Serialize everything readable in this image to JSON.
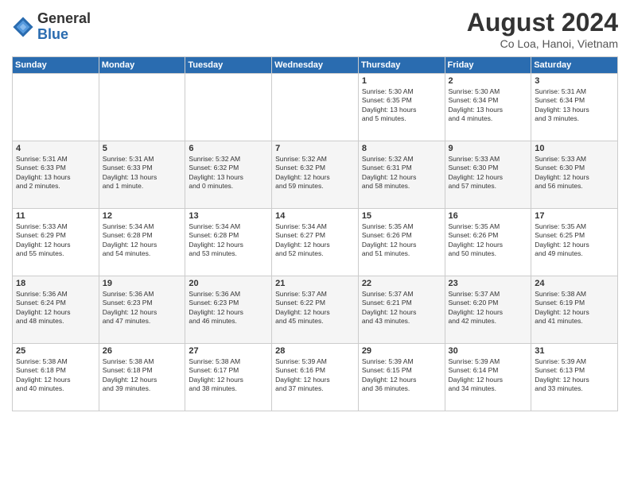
{
  "logo": {
    "general": "General",
    "blue": "Blue"
  },
  "header": {
    "month_year": "August 2024",
    "location": "Co Loa, Hanoi, Vietnam"
  },
  "days_of_week": [
    "Sunday",
    "Monday",
    "Tuesday",
    "Wednesday",
    "Thursday",
    "Friday",
    "Saturday"
  ],
  "weeks": [
    [
      {
        "day": "",
        "info": ""
      },
      {
        "day": "",
        "info": ""
      },
      {
        "day": "",
        "info": ""
      },
      {
        "day": "",
        "info": ""
      },
      {
        "day": "1",
        "info": "Sunrise: 5:30 AM\nSunset: 6:35 PM\nDaylight: 13 hours\nand 5 minutes."
      },
      {
        "day": "2",
        "info": "Sunrise: 5:30 AM\nSunset: 6:34 PM\nDaylight: 13 hours\nand 4 minutes."
      },
      {
        "day": "3",
        "info": "Sunrise: 5:31 AM\nSunset: 6:34 PM\nDaylight: 13 hours\nand 3 minutes."
      }
    ],
    [
      {
        "day": "4",
        "info": "Sunrise: 5:31 AM\nSunset: 6:33 PM\nDaylight: 13 hours\nand 2 minutes."
      },
      {
        "day": "5",
        "info": "Sunrise: 5:31 AM\nSunset: 6:33 PM\nDaylight: 13 hours\nand 1 minute."
      },
      {
        "day": "6",
        "info": "Sunrise: 5:32 AM\nSunset: 6:32 PM\nDaylight: 13 hours\nand 0 minutes."
      },
      {
        "day": "7",
        "info": "Sunrise: 5:32 AM\nSunset: 6:32 PM\nDaylight: 12 hours\nand 59 minutes."
      },
      {
        "day": "8",
        "info": "Sunrise: 5:32 AM\nSunset: 6:31 PM\nDaylight: 12 hours\nand 58 minutes."
      },
      {
        "day": "9",
        "info": "Sunrise: 5:33 AM\nSunset: 6:30 PM\nDaylight: 12 hours\nand 57 minutes."
      },
      {
        "day": "10",
        "info": "Sunrise: 5:33 AM\nSunset: 6:30 PM\nDaylight: 12 hours\nand 56 minutes."
      }
    ],
    [
      {
        "day": "11",
        "info": "Sunrise: 5:33 AM\nSunset: 6:29 PM\nDaylight: 12 hours\nand 55 minutes."
      },
      {
        "day": "12",
        "info": "Sunrise: 5:34 AM\nSunset: 6:28 PM\nDaylight: 12 hours\nand 54 minutes."
      },
      {
        "day": "13",
        "info": "Sunrise: 5:34 AM\nSunset: 6:28 PM\nDaylight: 12 hours\nand 53 minutes."
      },
      {
        "day": "14",
        "info": "Sunrise: 5:34 AM\nSunset: 6:27 PM\nDaylight: 12 hours\nand 52 minutes."
      },
      {
        "day": "15",
        "info": "Sunrise: 5:35 AM\nSunset: 6:26 PM\nDaylight: 12 hours\nand 51 minutes."
      },
      {
        "day": "16",
        "info": "Sunrise: 5:35 AM\nSunset: 6:26 PM\nDaylight: 12 hours\nand 50 minutes."
      },
      {
        "day": "17",
        "info": "Sunrise: 5:35 AM\nSunset: 6:25 PM\nDaylight: 12 hours\nand 49 minutes."
      }
    ],
    [
      {
        "day": "18",
        "info": "Sunrise: 5:36 AM\nSunset: 6:24 PM\nDaylight: 12 hours\nand 48 minutes."
      },
      {
        "day": "19",
        "info": "Sunrise: 5:36 AM\nSunset: 6:23 PM\nDaylight: 12 hours\nand 47 minutes."
      },
      {
        "day": "20",
        "info": "Sunrise: 5:36 AM\nSunset: 6:23 PM\nDaylight: 12 hours\nand 46 minutes."
      },
      {
        "day": "21",
        "info": "Sunrise: 5:37 AM\nSunset: 6:22 PM\nDaylight: 12 hours\nand 45 minutes."
      },
      {
        "day": "22",
        "info": "Sunrise: 5:37 AM\nSunset: 6:21 PM\nDaylight: 12 hours\nand 43 minutes."
      },
      {
        "day": "23",
        "info": "Sunrise: 5:37 AM\nSunset: 6:20 PM\nDaylight: 12 hours\nand 42 minutes."
      },
      {
        "day": "24",
        "info": "Sunrise: 5:38 AM\nSunset: 6:19 PM\nDaylight: 12 hours\nand 41 minutes."
      }
    ],
    [
      {
        "day": "25",
        "info": "Sunrise: 5:38 AM\nSunset: 6:18 PM\nDaylight: 12 hours\nand 40 minutes."
      },
      {
        "day": "26",
        "info": "Sunrise: 5:38 AM\nSunset: 6:18 PM\nDaylight: 12 hours\nand 39 minutes."
      },
      {
        "day": "27",
        "info": "Sunrise: 5:38 AM\nSunset: 6:17 PM\nDaylight: 12 hours\nand 38 minutes."
      },
      {
        "day": "28",
        "info": "Sunrise: 5:39 AM\nSunset: 6:16 PM\nDaylight: 12 hours\nand 37 minutes."
      },
      {
        "day": "29",
        "info": "Sunrise: 5:39 AM\nSunset: 6:15 PM\nDaylight: 12 hours\nand 36 minutes."
      },
      {
        "day": "30",
        "info": "Sunrise: 5:39 AM\nSunset: 6:14 PM\nDaylight: 12 hours\nand 34 minutes."
      },
      {
        "day": "31",
        "info": "Sunrise: 5:39 AM\nSunset: 6:13 PM\nDaylight: 12 hours\nand 33 minutes."
      }
    ]
  ]
}
